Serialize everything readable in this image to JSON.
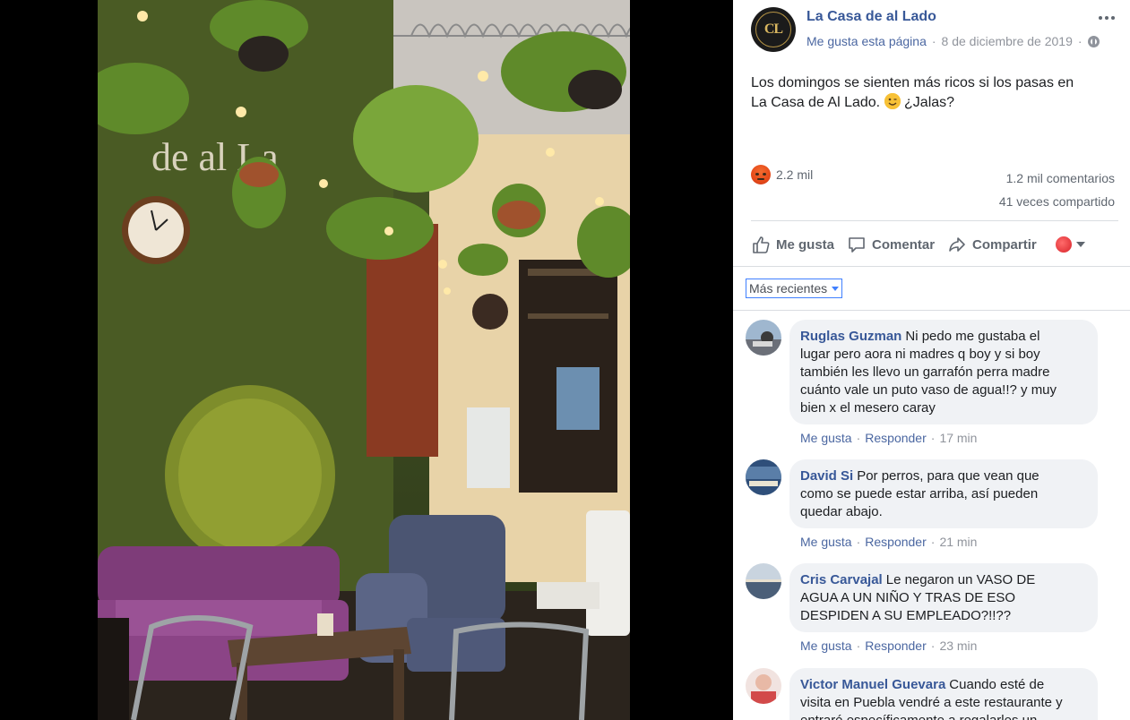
{
  "post": {
    "page_name": "La Casa de al Lado",
    "page_logo_text": "CL",
    "like_page": "Me gusta esta página",
    "separator": "·",
    "date": "8 de diciembre de 2019",
    "text_line1": "Los domingos se sienten más ricos si los pasas en",
    "text_line2_a": "La Casa de Al Lado.",
    "text_line2_b": "¿Jalas?",
    "reaction_count": "2.2 mil",
    "comment_count": "1.2 mil comentarios",
    "share_count": "41 veces compartido"
  },
  "actions": {
    "like": "Me gusta",
    "comment": "Comentar",
    "share": "Compartir"
  },
  "sort": {
    "label": "Más recientes"
  },
  "comments": [
    {
      "author": "Ruglas Guzman",
      "lines": [
        "Ni pedo me gustaba el",
        "lugar pero aora ni madres q boy y si boy",
        "también les llevo un garrafón perra madre",
        "cuánto vale un puto vaso de agua!!? y muy",
        "bien x el mesero caray"
      ],
      "like": "Me gusta",
      "reply": "Responder",
      "time": "17 min"
    },
    {
      "author": "David Si",
      "lines": [
        "Por perros, para que vean que",
        "como se puede estar arriba, así pueden",
        "quedar abajo."
      ],
      "like": "Me gusta",
      "reply": "Responder",
      "time": "21 min"
    },
    {
      "author": "Cris Carvajal",
      "lines": [
        "Le negaron un VASO DE",
        "AGUA A UN NIÑO Y TRAS DE ESO",
        "DESPIDEN A SU EMPLEADO?!!??"
      ],
      "like": "Me gusta",
      "reply": "Responder",
      "time": "23 min"
    },
    {
      "author": "Victor Manuel Guevara",
      "lines": [
        "Cuando esté de",
        "visita en Puebla vendré a este restaurante y",
        "entraré específicamente a regalarles un"
      ]
    }
  ],
  "photo": {
    "wall_sign": "de al La"
  },
  "colors": {
    "link_blue": "#385898",
    "meta_gray": "#90949c",
    "bubble_bg": "#f0f2f5"
  }
}
